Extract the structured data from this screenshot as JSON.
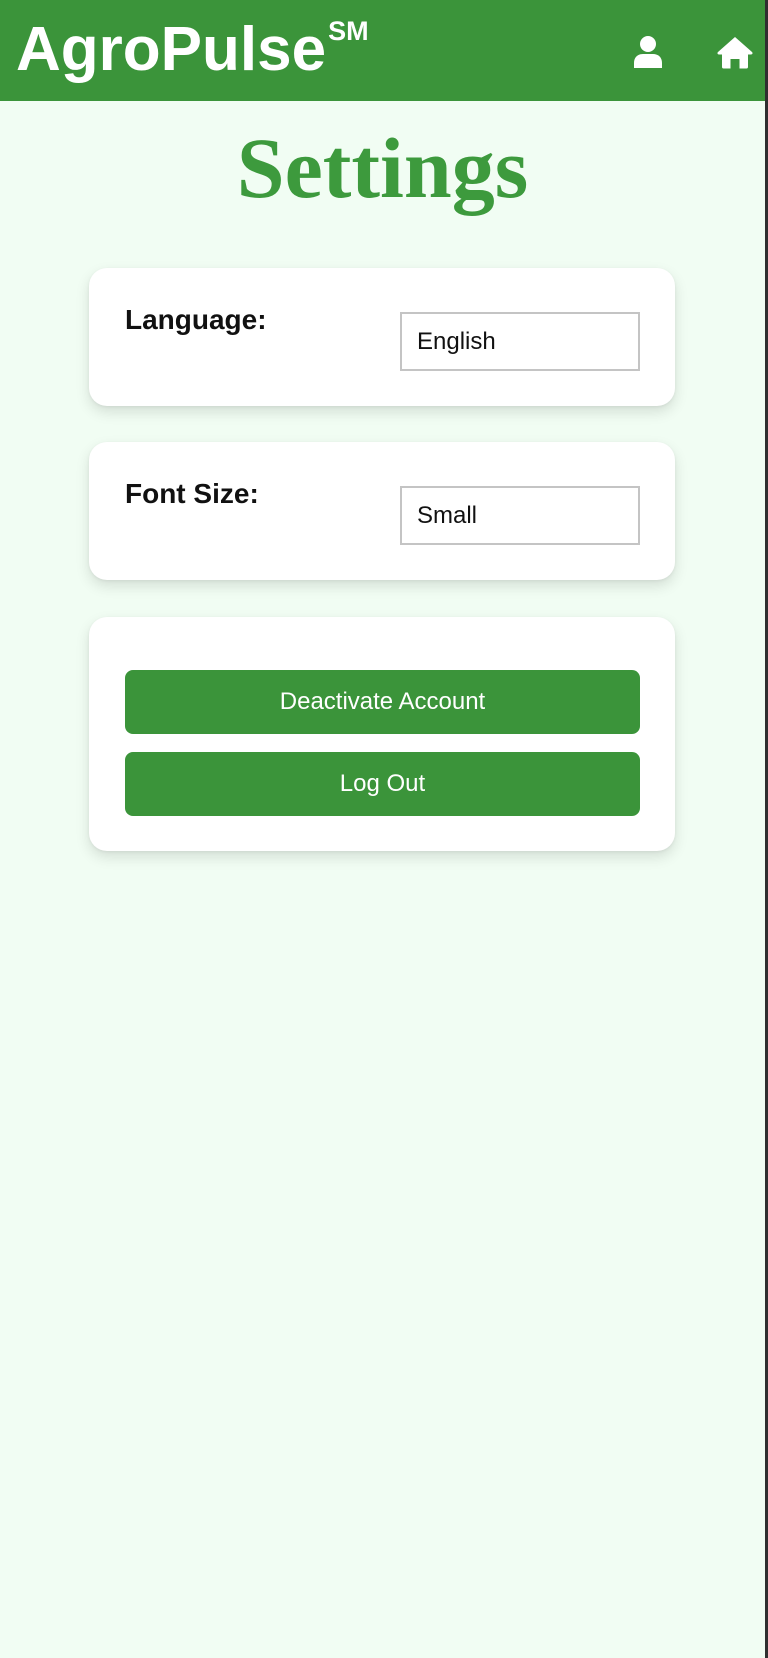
{
  "header": {
    "brand_name": "AgroPulse",
    "brand_mark": "SM",
    "user_icon": "user-icon",
    "home_icon": "home-icon",
    "bar_color": "#3b943a"
  },
  "page": {
    "title": "Settings",
    "title_color": "#3d9a3d",
    "background_color": "#f1fdf3"
  },
  "settings": {
    "language": {
      "label": "Language:",
      "value": "English"
    },
    "font_size": {
      "label": "Font Size:",
      "value": "Small"
    }
  },
  "actions": {
    "deactivate_label": "Deactivate Account",
    "logout_label": "Log Out"
  }
}
